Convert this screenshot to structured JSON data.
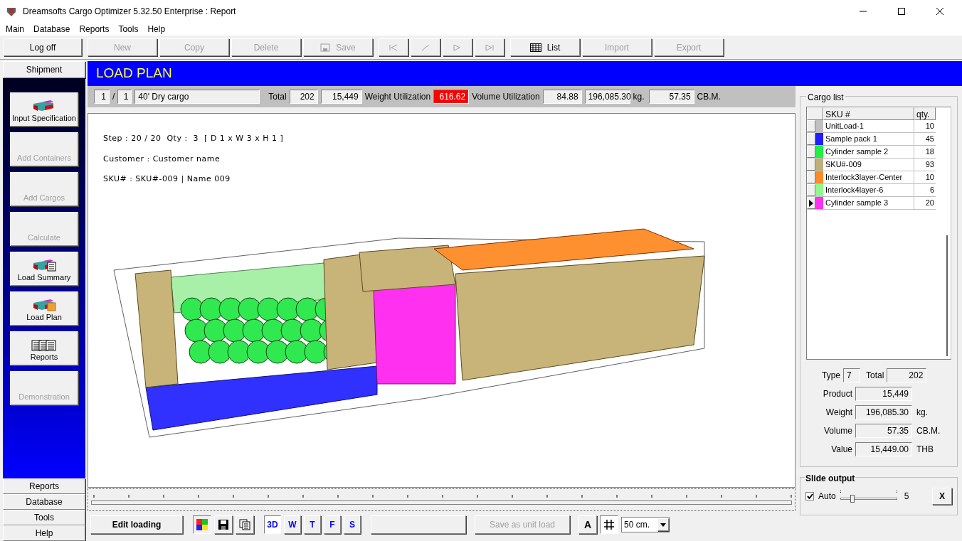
{
  "window": {
    "title": "Dreamsofts Cargo Optimizer 5.32.50 Enterprise : Report"
  },
  "menu": [
    "Main",
    "Database",
    "Reports",
    "Tools",
    "Help"
  ],
  "toolbar": [
    {
      "kind": "text",
      "label": "Log off",
      "disabled": false
    },
    {
      "kind": "text",
      "label": "New",
      "disabled": true
    },
    {
      "kind": "text",
      "label": "Copy",
      "disabled": true
    },
    {
      "kind": "text",
      "label": "Delete",
      "disabled": true
    },
    {
      "kind": "save",
      "label": "Save",
      "disabled": true
    },
    {
      "kind": "first",
      "disabled": true
    },
    {
      "kind": "prev",
      "disabled": true
    },
    {
      "kind": "next",
      "disabled": true
    },
    {
      "kind": "last",
      "disabled": true
    },
    {
      "kind": "list",
      "label": "List",
      "disabled": false
    },
    {
      "kind": "text",
      "label": "Import",
      "disabled": true
    },
    {
      "kind": "text",
      "label": "Export",
      "disabled": true
    }
  ],
  "sidebar": {
    "tab": "Shipment",
    "buttons": [
      {
        "kind": "cargo",
        "label": "Input Specification",
        "disabled": false
      },
      {
        "kind": "none",
        "label": "Add Containers",
        "disabled": true
      },
      {
        "kind": "none",
        "label": "Add Cargos",
        "disabled": true
      },
      {
        "kind": "none",
        "label": "Calculate",
        "disabled": true
      },
      {
        "kind": "summary",
        "label": "Load Summary",
        "disabled": false
      },
      {
        "kind": "plan",
        "label": "Load Plan",
        "disabled": false
      },
      {
        "kind": "reports",
        "label": "Reports",
        "disabled": false
      },
      {
        "kind": "none",
        "label": "Demonstration",
        "disabled": true
      }
    ],
    "sections": [
      "Reports",
      "Database",
      "Tools",
      "Help"
    ]
  },
  "header": {
    "title": "LOAD PLAN",
    "container_index": "1",
    "separator": "/",
    "container_count": "1",
    "container_name": "40' Dry cargo",
    "total_label": "Total",
    "total": "202",
    "product": "15,449",
    "weight_label": "Weight Utilization",
    "weight_utilization": "616.62",
    "weight_over": true,
    "volume_label": "Volume Utilization",
    "volume_utilization": "84.88",
    "weight": "196,085.30",
    "weight_unit": "kg.",
    "volume": "57.35",
    "volume_unit": "CB.M."
  },
  "canvas": {
    "lines": [
      "Step : 20 / 20  Qty :  3  [ D 1 x W 3 x H 1 ]",
      "Customer : Customer name",
      "SKU# : SKU#-009 | Name 009"
    ]
  },
  "cargo_list": {
    "title": "Cargo list",
    "columns": [
      "SKU #",
      "qty."
    ],
    "rows": [
      {
        "sku": "UnitLoad-1",
        "qty": "10",
        "color": "#c0c0c0",
        "selected": false
      },
      {
        "sku": "Sample pack 1",
        "qty": "45",
        "color": "#2020ff",
        "selected": false
      },
      {
        "sku": "Cylinder sample 2",
        "qty": "18",
        "color": "#20f040",
        "selected": false
      },
      {
        "sku": "SKU#-009",
        "qty": "93",
        "color": "#bfae7a",
        "selected": false
      },
      {
        "sku": "Interlock3layer-Center",
        "qty": "10",
        "color": "#ff8a2a",
        "selected": false
      },
      {
        "sku": "Interlock4layer-6",
        "qty": "6",
        "color": "#90f890",
        "selected": false
      },
      {
        "sku": "Cylinder sample 3",
        "qty": "20",
        "color": "#ff30f0",
        "selected": true
      }
    ]
  },
  "summary": {
    "type_label": "Type",
    "type": "7",
    "total_label": "Total",
    "total": "202",
    "fields": [
      {
        "label": "Product",
        "value": "15,449"
      },
      {
        "label": "Weight",
        "value": "196,085.30",
        "unit": "kg."
      },
      {
        "label": "Volume",
        "value": "57.35",
        "unit": "CB.M."
      },
      {
        "label": "Value",
        "value": "15,449.00",
        "unit": "THB"
      }
    ]
  },
  "slide_output": {
    "title": "Slide output",
    "auto_label": "Auto",
    "auto_checked": true,
    "level": 0.2,
    "reading": "5",
    "close": "X"
  },
  "bottom_bar": {
    "edit": "Edit loading",
    "views": [
      {
        "label": "3D",
        "selected": true
      },
      {
        "label": "W",
        "selected": false
      },
      {
        "label": "T",
        "selected": false
      },
      {
        "label": "F",
        "selected": false
      },
      {
        "label": "S",
        "selected": false
      }
    ],
    "save_unit": "Save as unit load",
    "font_button": "A",
    "grid_on": true,
    "scale": "50 cm."
  }
}
